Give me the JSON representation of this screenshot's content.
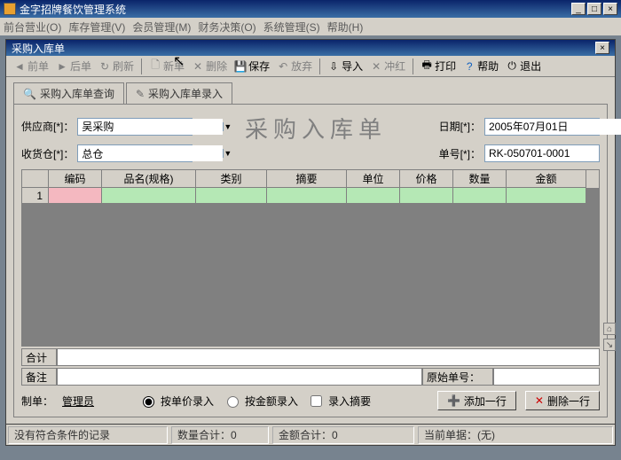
{
  "outer": {
    "title": "金字招牌餐饮管理系统",
    "menu": [
      "前台营业(O)",
      "库存管理(V)",
      "会员管理(M)",
      "财务决策(O)",
      "系统管理(S)",
      "帮助(H)"
    ]
  },
  "inner": {
    "title": "采购入库单",
    "toolbar": {
      "prev": "前单",
      "next": "后单",
      "refresh": "刷新",
      "new": "新单",
      "delete": "删除",
      "save": "保存",
      "discard": "放弃",
      "import": "导入",
      "reverse": "冲红",
      "print": "打印",
      "help": "帮助",
      "exit": "退出"
    },
    "tabs": {
      "query": "采购入库单查询",
      "entry": "采购入库单录入"
    },
    "form": {
      "supplier_label": "供应商[*]：",
      "supplier_value": "吴采购",
      "warehouse_label": "收货仓[*]：",
      "warehouse_value": "总仓",
      "big_title": "采购入库单",
      "date_label": "日期[*]：",
      "date_value": "2005年07月01日",
      "docno_label": "单号[*]：",
      "docno_value": "RK-050701-0001"
    },
    "grid": {
      "cols": [
        "",
        "编码",
        "品名(规格)",
        "类别",
        "摘要",
        "单位",
        "价格",
        "数量",
        "金额"
      ],
      "row0": [
        "1",
        "",
        "",
        "",
        "",
        "",
        "",
        "",
        ""
      ]
    },
    "totals": {
      "sum_label": "合计",
      "remark_label": "备注",
      "orig_label": "原始单号："
    },
    "footer": {
      "maker_label": "制单：",
      "maker": "管理员",
      "by_price": "按单价录入",
      "by_amount": "按金额录入",
      "with_summary": "录入摘要",
      "add_row": "添加一行",
      "del_row": "删除一行"
    }
  },
  "status": {
    "msg": "没有符合条件的记录",
    "qty": "数量合计：0",
    "amt": "金额合计：0",
    "cur": "当前单据：(无)"
  }
}
